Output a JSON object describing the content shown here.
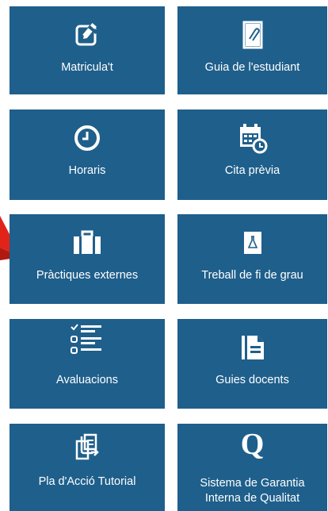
{
  "tiles": [
    {
      "label": "Matricula't",
      "icon": "edit-icon"
    },
    {
      "label": "Guia de l'estudiant",
      "icon": "clipboard-icon"
    },
    {
      "label": "Horaris",
      "icon": "clock-icon"
    },
    {
      "label": "Cita prèvia",
      "icon": "calendar-icon"
    },
    {
      "label": "Pràctiques externes",
      "icon": "briefcase-icon"
    },
    {
      "label": "Treball de fi de grau",
      "icon": "flask-icon"
    },
    {
      "label": "Avaluacions",
      "icon": "checklist-icon"
    },
    {
      "label": "Guies docents",
      "icon": "document-icon"
    },
    {
      "label": "Pla d'Acció Tutorial",
      "icon": "copy-icon"
    },
    {
      "label_line1": "Sistema de Garantia",
      "label_line2": "Interna de Qualitat",
      "icon": "q-icon"
    }
  ],
  "icon_glyphs": {
    "q": "Q"
  },
  "colors": {
    "tile": "#1f5f8b",
    "text": "#ffffff",
    "arrow": "#e2231a"
  }
}
